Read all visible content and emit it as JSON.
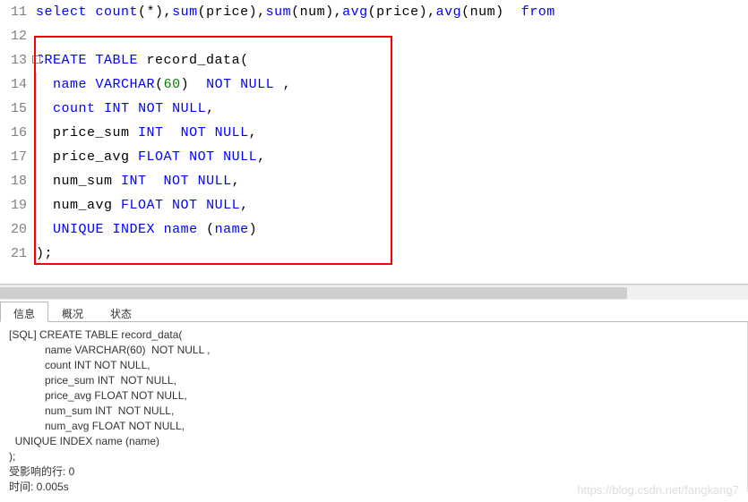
{
  "lines": [
    {
      "n": "11",
      "tokens": [
        {
          "t": "select",
          "c": "kw"
        },
        {
          "t": " "
        },
        {
          "t": "count",
          "c": "kw"
        },
        {
          "t": "(*),"
        },
        {
          "t": "sum",
          "c": "kw"
        },
        {
          "t": "(price),"
        },
        {
          "t": "sum",
          "c": "kw"
        },
        {
          "t": "(num),"
        },
        {
          "t": "avg",
          "c": "kw"
        },
        {
          "t": "(price),"
        },
        {
          "t": "avg",
          "c": "kw"
        },
        {
          "t": "(num)  "
        },
        {
          "t": "from",
          "c": "kw"
        }
      ]
    },
    {
      "n": "12",
      "tokens": []
    },
    {
      "n": "13",
      "fold": true,
      "tokens": [
        {
          "t": "CREATE",
          "c": "kw"
        },
        {
          "t": " "
        },
        {
          "t": "TABLE",
          "c": "kw"
        },
        {
          "t": " record_data("
        }
      ]
    },
    {
      "n": "14",
      "foldline": true,
      "tokens": [
        {
          "t": "  "
        },
        {
          "t": "name",
          "c": "kw"
        },
        {
          "t": " "
        },
        {
          "t": "VARCHAR",
          "c": "kw"
        },
        {
          "t": "("
        },
        {
          "t": "60",
          "c": "num"
        },
        {
          "t": ")  "
        },
        {
          "t": "NOT",
          "c": "kw"
        },
        {
          "t": " "
        },
        {
          "t": "NULL",
          "c": "kw"
        },
        {
          "t": " ,"
        }
      ]
    },
    {
      "n": "15",
      "foldline": true,
      "tokens": [
        {
          "t": "  "
        },
        {
          "t": "count",
          "c": "kw"
        },
        {
          "t": " "
        },
        {
          "t": "INT",
          "c": "kw"
        },
        {
          "t": " "
        },
        {
          "t": "NOT",
          "c": "kw"
        },
        {
          "t": " "
        },
        {
          "t": "NULL",
          "c": "kw"
        },
        {
          "t": ","
        }
      ]
    },
    {
      "n": "16",
      "foldline": true,
      "tokens": [
        {
          "t": "  price_sum "
        },
        {
          "t": "INT",
          "c": "kw"
        },
        {
          "t": "  "
        },
        {
          "t": "NOT",
          "c": "kw"
        },
        {
          "t": " "
        },
        {
          "t": "NULL",
          "c": "kw"
        },
        {
          "t": ","
        }
      ]
    },
    {
      "n": "17",
      "foldline": true,
      "tokens": [
        {
          "t": "  price_avg "
        },
        {
          "t": "FLOAT",
          "c": "kw"
        },
        {
          "t": " "
        },
        {
          "t": "NOT",
          "c": "kw"
        },
        {
          "t": " "
        },
        {
          "t": "NULL",
          "c": "kw"
        },
        {
          "t": ","
        }
      ]
    },
    {
      "n": "18",
      "foldline": true,
      "tokens": [
        {
          "t": "  num_sum "
        },
        {
          "t": "INT",
          "c": "kw"
        },
        {
          "t": "  "
        },
        {
          "t": "NOT",
          "c": "kw"
        },
        {
          "t": " "
        },
        {
          "t": "NULL",
          "c": "kw"
        },
        {
          "t": ","
        }
      ]
    },
    {
      "n": "19",
      "foldline": true,
      "tokens": [
        {
          "t": "  num_avg "
        },
        {
          "t": "FLOAT",
          "c": "kw"
        },
        {
          "t": " "
        },
        {
          "t": "NOT",
          "c": "kw"
        },
        {
          "t": " "
        },
        {
          "t": "NULL",
          "c": "kw"
        },
        {
          "t": ","
        }
      ]
    },
    {
      "n": "20",
      "foldline": true,
      "tokens": [
        {
          "t": "  "
        },
        {
          "t": "UNIQUE",
          "c": "kw"
        },
        {
          "t": " "
        },
        {
          "t": "INDEX",
          "c": "kw"
        },
        {
          "t": " "
        },
        {
          "t": "name",
          "c": "kw"
        },
        {
          "t": " ("
        },
        {
          "t": "name",
          "c": "kw"
        },
        {
          "t": ")"
        }
      ]
    },
    {
      "n": "21",
      "foldline": true,
      "tokens": [
        {
          "t": ");"
        }
      ]
    }
  ],
  "tabs": {
    "info": "信息",
    "overview": "概况",
    "status": "状态"
  },
  "output_lines": [
    "[SQL] CREATE TABLE record_data(",
    "            name VARCHAR(60)  NOT NULL ,",
    "            count INT NOT NULL,",
    "            price_sum INT  NOT NULL,",
    "            price_avg FLOAT NOT NULL,",
    "            num_sum INT  NOT NULL,",
    "            num_avg FLOAT NOT NULL,",
    "  UNIQUE INDEX name (name)",
    ");",
    "受影响的行: 0",
    "时间: 0.005s"
  ],
  "watermark": "https://blog.csdn.net/fangkang7"
}
